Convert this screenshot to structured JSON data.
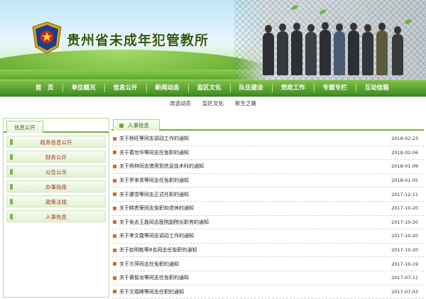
{
  "header": {
    "title": "贵州省未成年犯管教所"
  },
  "nav": {
    "items": [
      "首　页",
      "单位概况",
      "信息公开",
      "新闻动态",
      "监区文化",
      "队伍建设",
      "党政工作",
      "专题专栏",
      "互动信箱"
    ]
  },
  "subnav": {
    "items": [
      "改造动态",
      "监区文化",
      "新生之路"
    ]
  },
  "sidebar": {
    "tab": "信息公开",
    "items": [
      "政务信息公开",
      "财务公开",
      "公告公示",
      "办事指南",
      "政策法规",
      "人事信息"
    ]
  },
  "content": {
    "tab": "人事信息",
    "rows": [
      {
        "title": "关于杨旺等同志调动工作的通知",
        "date": "2018-02-23"
      },
      {
        "title": "关于葛世华等同志任免职的通知",
        "date": "2018-02-06"
      },
      {
        "title": "关于杨林同志借用到信息技术科的通知",
        "date": "2018-01-09"
      },
      {
        "title": "关于罗来青等同志任免职的通知",
        "date": "2018-01-05"
      },
      {
        "title": "关于康雪等同志正式任职的通知",
        "date": "2017-12-11"
      },
      {
        "title": "关于韩贵荣同志免职和退休的通知",
        "date": "2017-10-20"
      },
      {
        "title": "关于免去王磊同志医院副院长职务的通知",
        "date": "2017-10-20"
      },
      {
        "title": "关于李文霞等同志调动工作的通知",
        "date": "2017-10-20"
      },
      {
        "title": "关于赵明乾等8名同志任免职的通知",
        "date": "2017-10-20"
      },
      {
        "title": "关于方萍同志任免职的通知",
        "date": "2017-10-19"
      },
      {
        "title": "关于黄智龙等同志任免职的通知",
        "date": "2017-07-11"
      },
      {
        "title": "关于文福峰等同志任职的通知",
        "date": "2017-07-03"
      }
    ]
  },
  "colors": {
    "nav_green": "#4e9a2a",
    "accent_orange": "#e0622a",
    "sidebar_text": "#a03a1c"
  }
}
